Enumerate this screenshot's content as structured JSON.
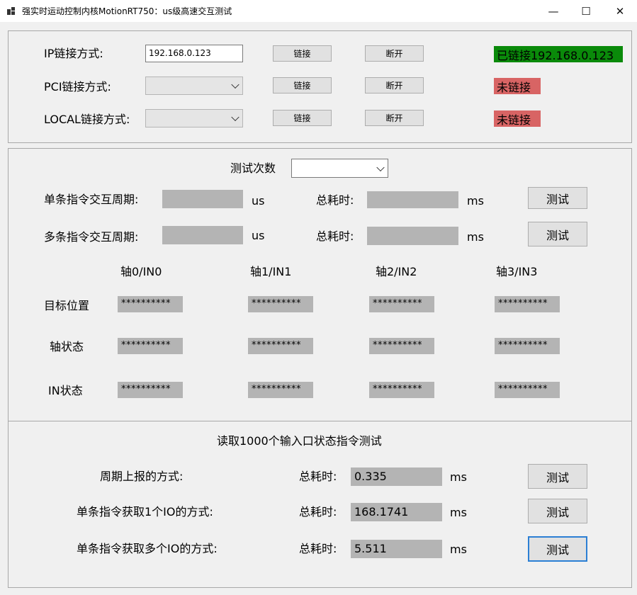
{
  "window": {
    "title": "强实时运动控制内核MotionRT750：us级高速交互测试",
    "min_glyph": "—",
    "max_glyph": "☐",
    "close_glyph": "✕"
  },
  "connect": {
    "ip_label": "IP链接方式:",
    "ip_value": "192.168.0.123",
    "pci_label": "PCI链接方式:",
    "local_label": "LOCAL链接方式:",
    "connect_btn": "链接",
    "disconnect_btn": "断开",
    "ip_status": "已链接192.168.0.123",
    "pci_status": "未链接",
    "local_status": "未链接",
    "connected_color": "#0a8a0a",
    "disconnected_color": "#d86464"
  },
  "test": {
    "count_label": "测试次数",
    "count_value": "",
    "single_label": "单条指令交互周期:",
    "multi_label": "多条指令交互周期:",
    "unit_us": "us",
    "total_label": "总耗时:",
    "unit_ms": "ms",
    "test_btn": "测试"
  },
  "axes": {
    "headers": [
      "轴0/IN0",
      "轴1/IN1",
      "轴2/IN2",
      "轴3/IN3"
    ],
    "rows": [
      {
        "label": "目标位置",
        "values": [
          "**********",
          "**********",
          "**********",
          "**********"
        ]
      },
      {
        "label": "轴状态",
        "values": [
          "**********",
          "**********",
          "**********",
          "**********"
        ]
      },
      {
        "label": "IN状态",
        "values": [
          "**********",
          "**********",
          "**********",
          "**********"
        ]
      }
    ]
  },
  "io": {
    "title": "读取1000个输入口状态指令测试",
    "total_label": "总耗时:",
    "unit_ms": "ms",
    "test_btn": "测试",
    "rows": [
      {
        "label": "周期上报的方式:",
        "value": "0.335"
      },
      {
        "label": "单条指令获取1个IO的方式:",
        "value": "168.1741"
      },
      {
        "label": "单条指令获取多个IO的方式:",
        "value": "5.511"
      }
    ]
  }
}
